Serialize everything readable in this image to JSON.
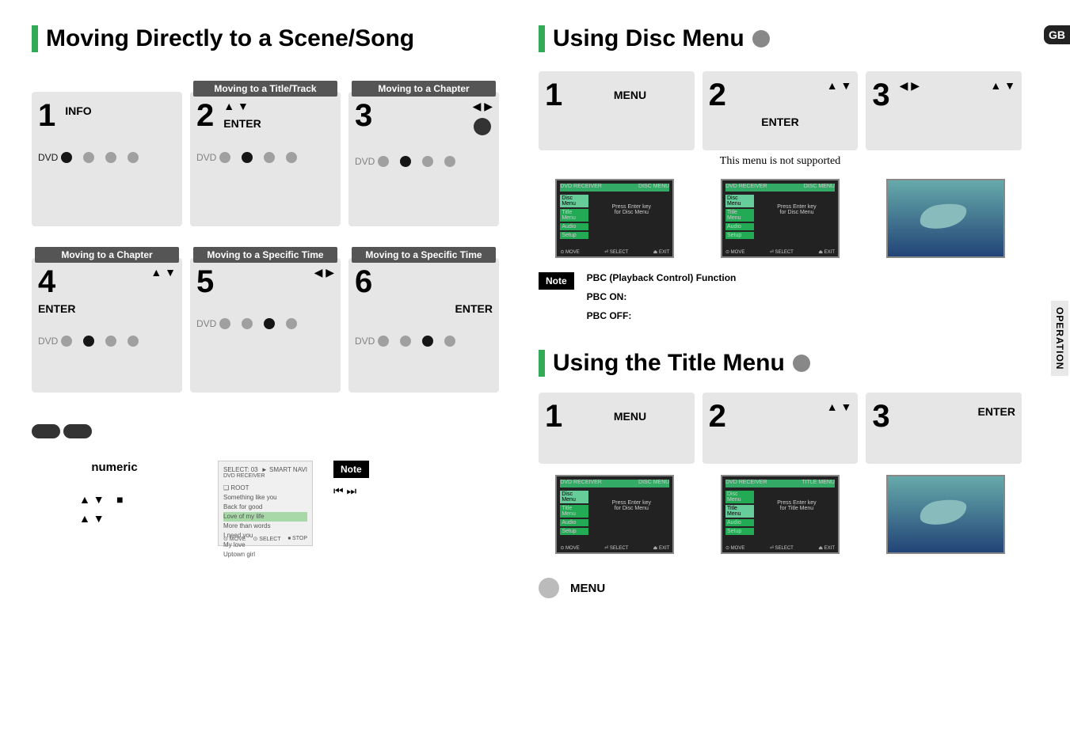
{
  "pageTag": "GB",
  "sideTab": "OPERATION",
  "left": {
    "heading": "Moving Directly to a Scene/Song",
    "steps": [
      {
        "num": "1",
        "title": "",
        "label": "INFO",
        "arrows": "",
        "activeIcon": 0
      },
      {
        "num": "2",
        "title": "Moving to a Title/Track",
        "label": "ENTER",
        "arrows": "▲ ▼",
        "activeIcon": 1
      },
      {
        "num": "3",
        "title": "Moving to a Chapter",
        "label": "",
        "arrows": "◀ ▶",
        "activeIcon": 1
      },
      {
        "num": "4",
        "title": "Moving to a Chapter",
        "label": "ENTER",
        "arrows": "▲ ▼",
        "activeIcon": 1
      },
      {
        "num": "5",
        "title": "Moving to a Specific Time",
        "label": "",
        "arrows": "◀ ▶",
        "activeIcon": 2
      },
      {
        "num": "6",
        "title": "Moving to a Specific Time",
        "label": "ENTER",
        "arrows": "",
        "activeIcon": 2
      }
    ],
    "osdLabel": "DVD",
    "mp3": {
      "numericLabel": "numeric",
      "noteLabel": "Note",
      "skipIcons": "⏮ ⏭",
      "remote": {
        "header_l": "SELECT:",
        "header_n": "03",
        "header_r": "► SMART NAVI",
        "brand": "DVD RECEIVER",
        "root": "❑ ROOT",
        "songs": [
          "Something like you",
          "Back for good",
          "Love of my life",
          "More than words",
          "I need you",
          "My love",
          "Uptown girl"
        ],
        "foot_move": "⊙ MOVE",
        "foot_select": "⊙ SELECT",
        "foot_stop": "⏹ STOP"
      },
      "stopGlyph": "■"
    }
  },
  "right": {
    "discMenu": {
      "heading": "Using Disc Menu",
      "steps": [
        {
          "num": "1",
          "label": "MENU",
          "arrows": ""
        },
        {
          "num": "2",
          "label": "ENTER",
          "arrows": "▲ ▼"
        },
        {
          "num": "3",
          "label": "",
          "arrows2": "◀ ▶",
          "arrows": "▲ ▼"
        }
      ],
      "notSupported": "This menu is not supported",
      "miniMenu": {
        "hdr_l": "DVD RECEIVER",
        "hdr_r": "DISC MENU",
        "items": [
          "Disc Menu",
          "Title Menu",
          "Audio",
          "Setup"
        ],
        "msg1": "Press Enter key",
        "msg2": "for Disc Menu",
        "foot_move": "⊙ MOVE",
        "foot_select": "⏎ SELECT",
        "foot_exit": "⏏ EXIT"
      },
      "note": {
        "badge": "Note",
        "line1": "PBC (Playback Control) Function",
        "line2": "PBC ON:",
        "line3": "PBC OFF:"
      }
    },
    "titleMenu": {
      "heading": "Using the Title Menu",
      "steps": [
        {
          "num": "1",
          "label": "MENU",
          "arrows": ""
        },
        {
          "num": "2",
          "label": "",
          "arrows": "▲ ▼"
        },
        {
          "num": "3",
          "label": "ENTER",
          "arrows": ""
        }
      ],
      "miniMenu2": {
        "hdr_l": "DVD RECEIVER",
        "hdr_r": "TITLE MENU",
        "msg1": "Press Enter key",
        "msg2": "for Title Menu"
      }
    },
    "footer": "MENU"
  }
}
